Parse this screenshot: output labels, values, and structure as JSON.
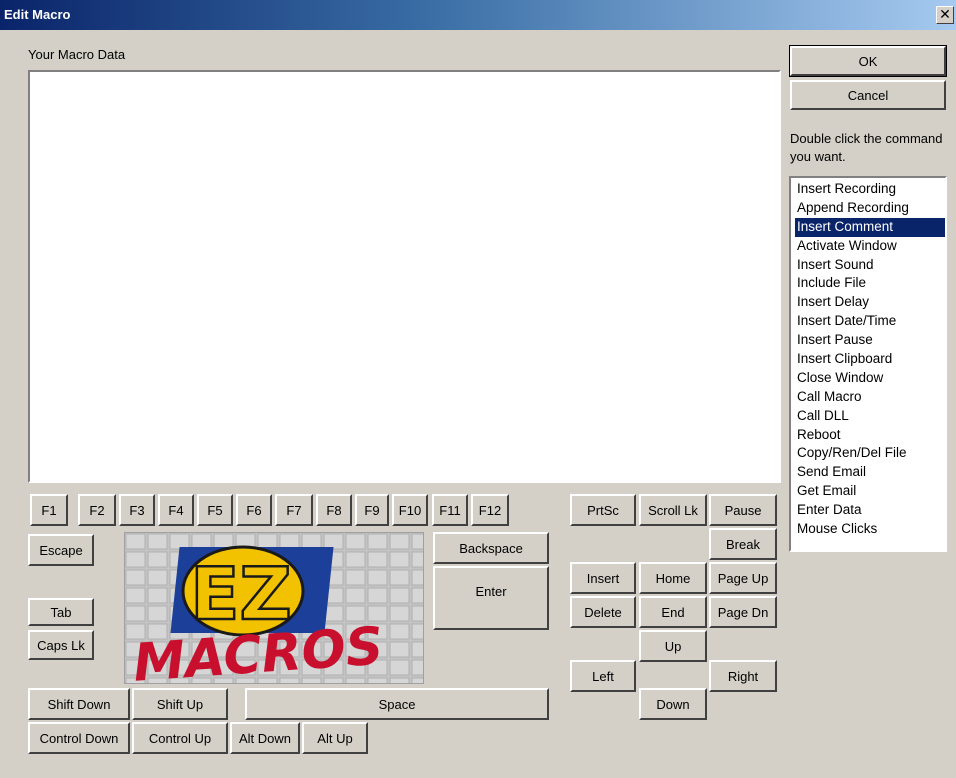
{
  "window": {
    "title": "Edit Macro",
    "close_glyph": "✕"
  },
  "macro_label": "Your Macro Data",
  "macro_text": "",
  "buttons": {
    "ok": "OK",
    "cancel": "Cancel"
  },
  "instructions": "Double click the command you want.",
  "commands": {
    "selected": "Insert Comment",
    "items": [
      "Insert Recording",
      "Append Recording",
      "Insert Comment",
      "Activate Window",
      "Insert Sound",
      "Include File",
      "Insert Delay",
      "Insert Date/Time",
      "Insert Pause",
      "Insert Clipboard",
      "Close Window",
      "Call Macro",
      "Call DLL",
      "Reboot",
      "Copy/Ren/Del File",
      "Send Email",
      "Get Email",
      "Enter Data",
      "Mouse Clicks"
    ]
  },
  "fkeys": [
    "F1",
    "F2",
    "F3",
    "F4",
    "F5",
    "F6",
    "F7",
    "F8",
    "F9",
    "F10",
    "F11",
    "F12"
  ],
  "keys": {
    "escape": "Escape",
    "tab": "Tab",
    "caps_lock": "Caps Lk",
    "backspace": "Backspace",
    "enter": "Enter",
    "prtsc": "PrtSc",
    "scroll_lock": "Scroll Lk",
    "pause": "Pause",
    "break": "Break",
    "insert": "Insert",
    "home": "Home",
    "page_up": "Page Up",
    "delete": "Delete",
    "end": "End",
    "page_down": "Page Dn",
    "up": "Up",
    "left": "Left",
    "right": "Right",
    "down": "Down",
    "shift_down": "Shift Down",
    "shift_up": "Shift Up",
    "space": "Space",
    "control_down": "Control Down",
    "control_up": "Control Up",
    "alt_down": "Alt Down",
    "alt_up": "Alt Up"
  },
  "logo": {
    "letters": "EZ",
    "wordmark": "MACROS"
  },
  "colors": {
    "selection": "#0a246a",
    "logo_red": "#c8102e",
    "logo_yellow": "#f2c200",
    "logo_blue": "#1c3f9a"
  }
}
